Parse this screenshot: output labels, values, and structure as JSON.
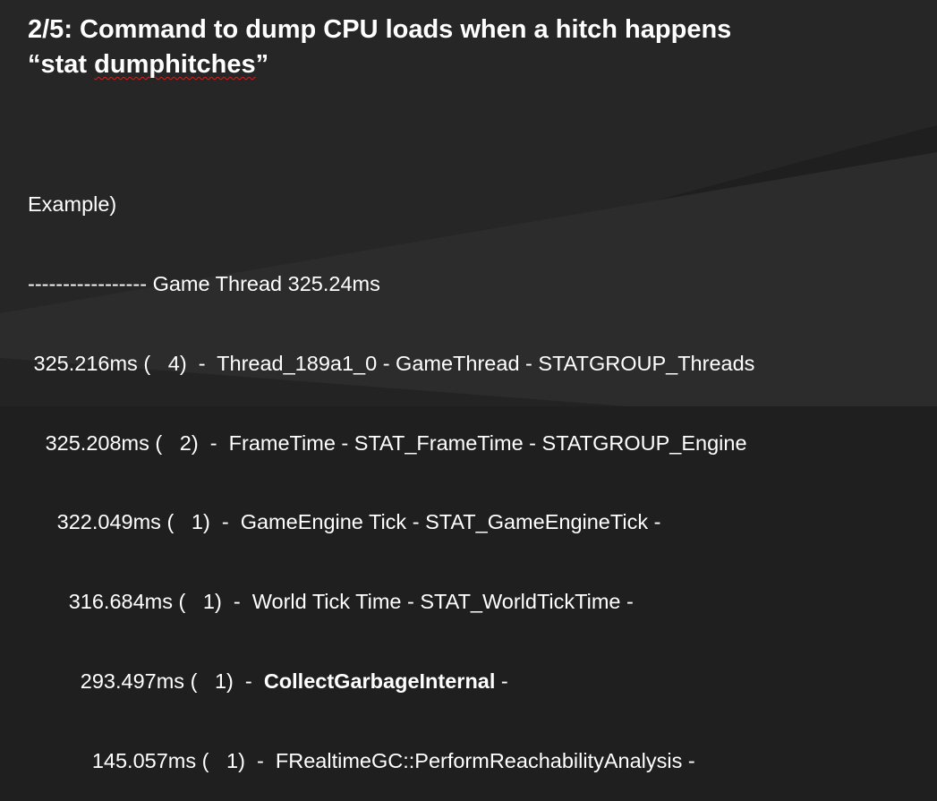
{
  "slide": {
    "title_line1": "2/5: Command to dump CPU loads when a hitch happens",
    "title_line2_open": "“stat ",
    "title_line2_word": "dumphitches",
    "title_line2_close": "”",
    "example_label": "Example)",
    "header_line": "----------------- Game Thread 325.24ms",
    "rows": [
      {
        "indent": " ",
        "text": "325.216ms (   4)  -  Thread_189a1_0 - GameThread - STATGROUP_Threads",
        "bold": "",
        "after": ""
      },
      {
        "indent": "   ",
        "text": "325.208ms (   2)  -  FrameTime - STAT_FrameTime - STATGROUP_Engine",
        "bold": "",
        "after": ""
      },
      {
        "indent": "     ",
        "text": "322.049ms (   1)  -  GameEngine Tick - STAT_GameEngineTick -",
        "bold": "",
        "after": ""
      },
      {
        "indent": "       ",
        "text": "316.684ms (   1)  -  World Tick Time - STAT_WorldTickTime -",
        "bold": "",
        "after": ""
      },
      {
        "indent": "         ",
        "text": "293.497ms (   1)  -  ",
        "bold": "CollectGarbageInternal",
        "after": " -"
      },
      {
        "indent": "           ",
        "text": "145.057ms (   1)  -  FRealtimeGC::PerformReachabilityAnalysis -",
        "bold": "",
        "after": ""
      }
    ]
  },
  "colors": {
    "background": "#1f1f1f",
    "accent_band": "#2c2c2c",
    "text": "#ffffff",
    "spellcheck_underline": "#d02020"
  }
}
